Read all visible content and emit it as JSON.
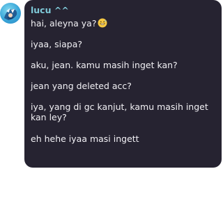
{
  "chat": {
    "sender_name": "lucu ^^",
    "avatar_icon": "anime-avatar-icon",
    "messages": [
      "hai, aleyna ya?",
      "iyaa, siapa?",
      "aku, jean. kamu masih inget kan?",
      "jean yang deleted acc?",
      "iya, yang di gc kanjut, kamu masih inget kan ley?",
      "eh hehe iyaa masi ingett"
    ],
    "first_message_emoji": "grinning-sweat-emoji",
    "colors": {
      "bubble_bg": "#262331",
      "sender_color": "#7fc9d8",
      "text_color": "#f1f0f4"
    }
  }
}
